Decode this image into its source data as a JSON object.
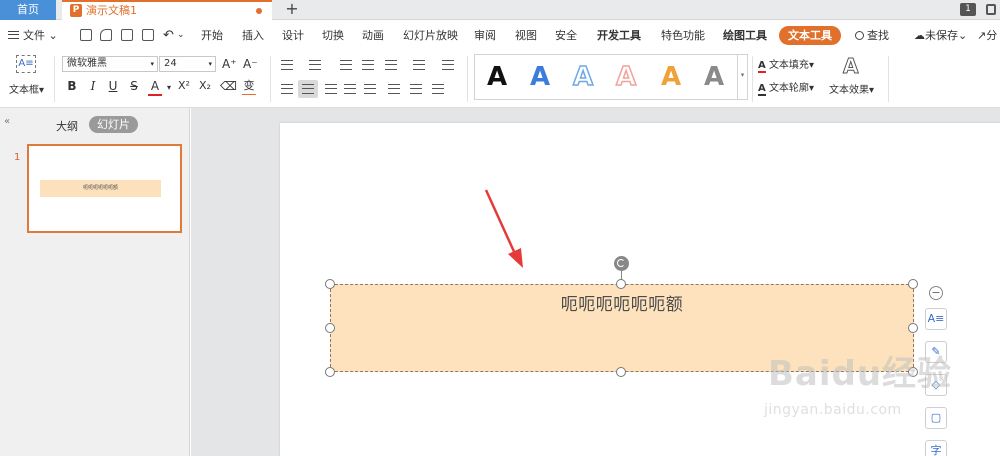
{
  "tabs": {
    "home": "首页",
    "document": "演示文稿1",
    "add": "+",
    "right_number": "1"
  },
  "menu": {
    "file": "文件",
    "tabs": [
      "开始",
      "插入",
      "设计",
      "切换",
      "动画",
      "幻灯片放映",
      "审阅",
      "视图",
      "安全",
      "开发工具",
      "特色功能",
      "绘图工具",
      "文本工具"
    ],
    "active_tab": "文本工具",
    "search": "查找",
    "unsaved": "未保存",
    "share": "分"
  },
  "ribbon": {
    "textbox_label": "文本框",
    "font_name": "微软雅黑",
    "font_size": "24",
    "bold": "B",
    "italic": "I",
    "underline": "U",
    "strike": "S",
    "font_color": "A",
    "superscript": "X²",
    "subscript": "X₂",
    "phonetic": "变",
    "grow_font": "A⁺",
    "shrink_font": "A⁻",
    "text_fill": "文本填充",
    "text_outline": "文本轮廓",
    "text_effect": "文本效果",
    "style_letter": "A",
    "style_colors": [
      "#111111",
      "#3c7ddb",
      "#6ea9e6",
      "#f2a39a",
      "#f0a23a",
      "#8a8a8a"
    ]
  },
  "panel": {
    "outline_tab": "大纲",
    "slides_tab": "幻灯片",
    "slide_number": "1",
    "thumb_text": "呃呃呃呃呃呃额"
  },
  "slide": {
    "textbox_text": "呃呃呃呃呃呃额"
  },
  "side_tools": {
    "minus": "−",
    "tool_icons": [
      "text-layout-icon",
      "brush-icon",
      "fill-icon",
      "frame-icon",
      "char-icon"
    ]
  },
  "watermark": {
    "logo": "Baidu经验",
    "url": "jingyan.baidu.com"
  },
  "colors": {
    "accent": "#e0702b",
    "home_tab": "#4a90d9",
    "textbox_fill": "#fde2bd",
    "arrow": "#e53a3a"
  }
}
